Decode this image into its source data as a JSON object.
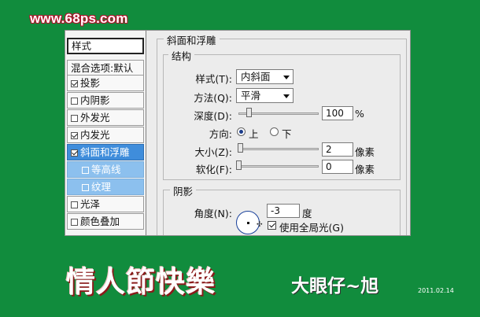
{
  "watermark": "www.68ps.com",
  "styles_panel": {
    "header": "样式",
    "blend_options": "混合选项:默认",
    "items": [
      {
        "label": "投影",
        "checked": true
      },
      {
        "label": "内阴影",
        "checked": false
      },
      {
        "label": "外发光",
        "checked": false
      },
      {
        "label": "内发光",
        "checked": true
      },
      {
        "label": "斜面和浮雕",
        "checked": true
      },
      {
        "label": "等高线",
        "checked": false
      },
      {
        "label": "纹理",
        "checked": false
      },
      {
        "label": "光泽",
        "checked": false
      },
      {
        "label": "颜色叠加",
        "checked": false
      }
    ]
  },
  "bevel": {
    "title": "斜面和浮雕",
    "structure": {
      "title": "结构",
      "style_label": "样式(T):",
      "style_value": "内斜面",
      "technique_label": "方法(Q):",
      "technique_value": "平滑",
      "depth_label": "深度(D):",
      "depth_value": "100",
      "depth_unit": "%",
      "direction_label": "方向:",
      "direction_up": "上",
      "direction_down": "下",
      "size_label": "大小(Z):",
      "size_value": "2",
      "size_unit": "像素",
      "soften_label": "软化(F):",
      "soften_value": "0",
      "soften_unit": "像素"
    },
    "shading": {
      "title": "阴影",
      "angle_label": "角度(N):",
      "angle_value": "-3",
      "angle_unit": "度",
      "global_light_label": "使用全局光(G)",
      "global_light_checked": true
    }
  },
  "caption": {
    "title": "情人節快樂",
    "signature": "大眼仔~旭",
    "date": "2011.02.14"
  },
  "colors": {
    "background": "#118c3d",
    "selected": "#3f8ddb",
    "sub_item": "#8cc0ee"
  }
}
